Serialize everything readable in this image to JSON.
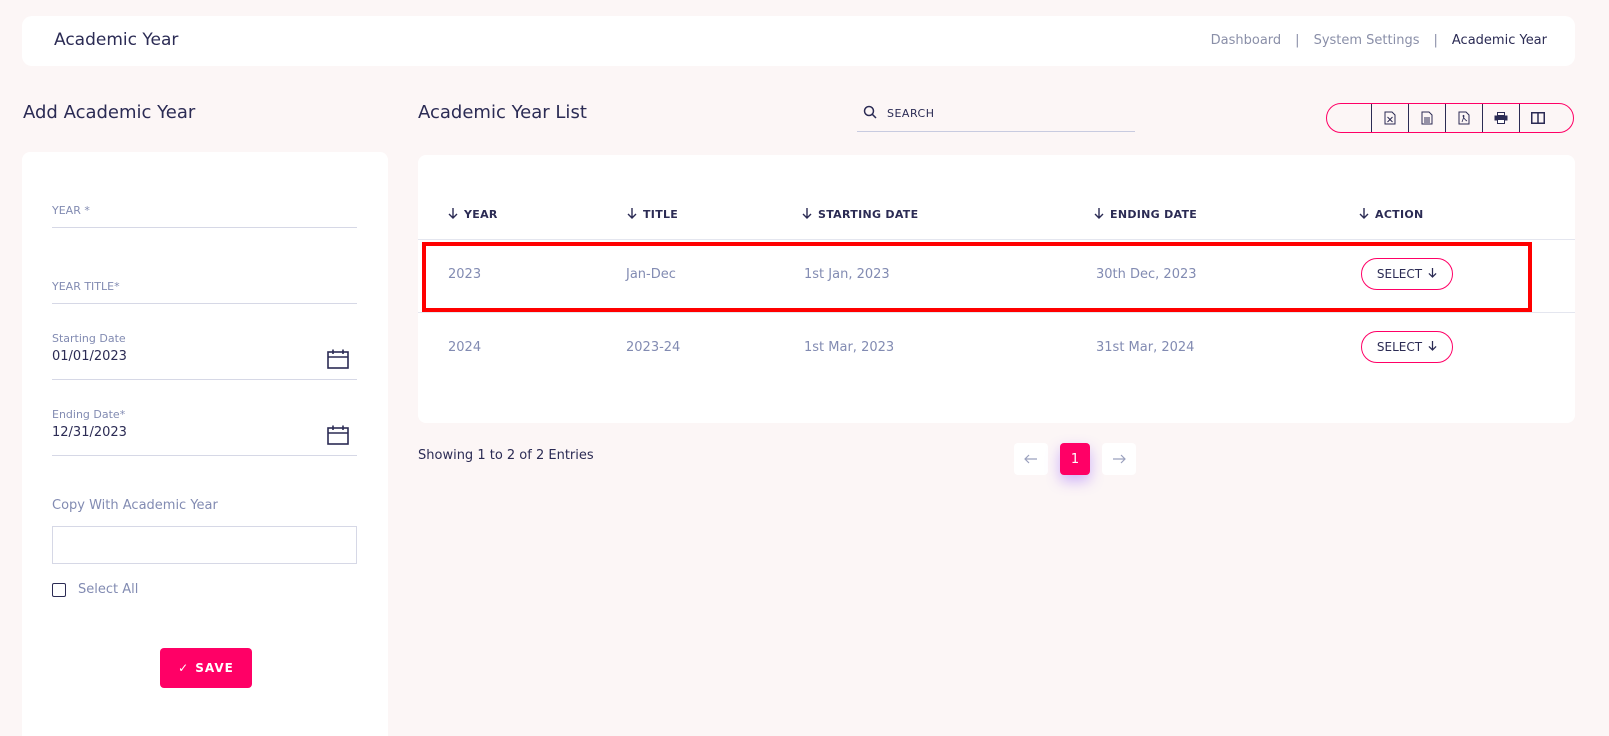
{
  "header": {
    "title": "Academic Year",
    "breadcrumbs": [
      "Dashboard",
      "System Settings",
      "Academic Year"
    ],
    "separator": "|"
  },
  "form": {
    "section_title": "Add Academic Year",
    "year_label": "YEAR *",
    "year_title_label": "YEAR TITLE*",
    "starting_date_label": "Starting Date",
    "starting_date_value": "01/01/2023",
    "ending_date_label": "Ending Date*",
    "ending_date_value": "12/31/2023",
    "copy_label": "Copy With Academic Year",
    "select_all_label": "Select All",
    "save_label": "SAVE",
    "save_check": "✓"
  },
  "list": {
    "section_title": "Academic Year List",
    "search_placeholder": "SEARCH",
    "columns": [
      "YEAR",
      "TITLE",
      "STARTING DATE",
      "ENDING DATE",
      "ACTION"
    ],
    "rows": [
      {
        "year": "2023",
        "title": "Jan-Dec",
        "start": "1st Jan, 2023",
        "end": "30th Dec, 2023",
        "action": "SELECT"
      },
      {
        "year": "2024",
        "title": "2023-24",
        "start": "1st Mar, 2023",
        "end": "31st Mar, 2024",
        "action": "SELECT"
      }
    ],
    "showing": "Showing 1 to 2 of 2 Entries",
    "current_page": "1"
  },
  "toolbar": {
    "icons": [
      "blank",
      "excel-icon",
      "csv-icon",
      "pdf-icon",
      "print-icon",
      "columns-icon"
    ]
  },
  "colors": {
    "accent": "#ff0066",
    "highlight": "#ff0000",
    "text_dark": "#2b2b54",
    "text_muted": "#828bb2"
  }
}
